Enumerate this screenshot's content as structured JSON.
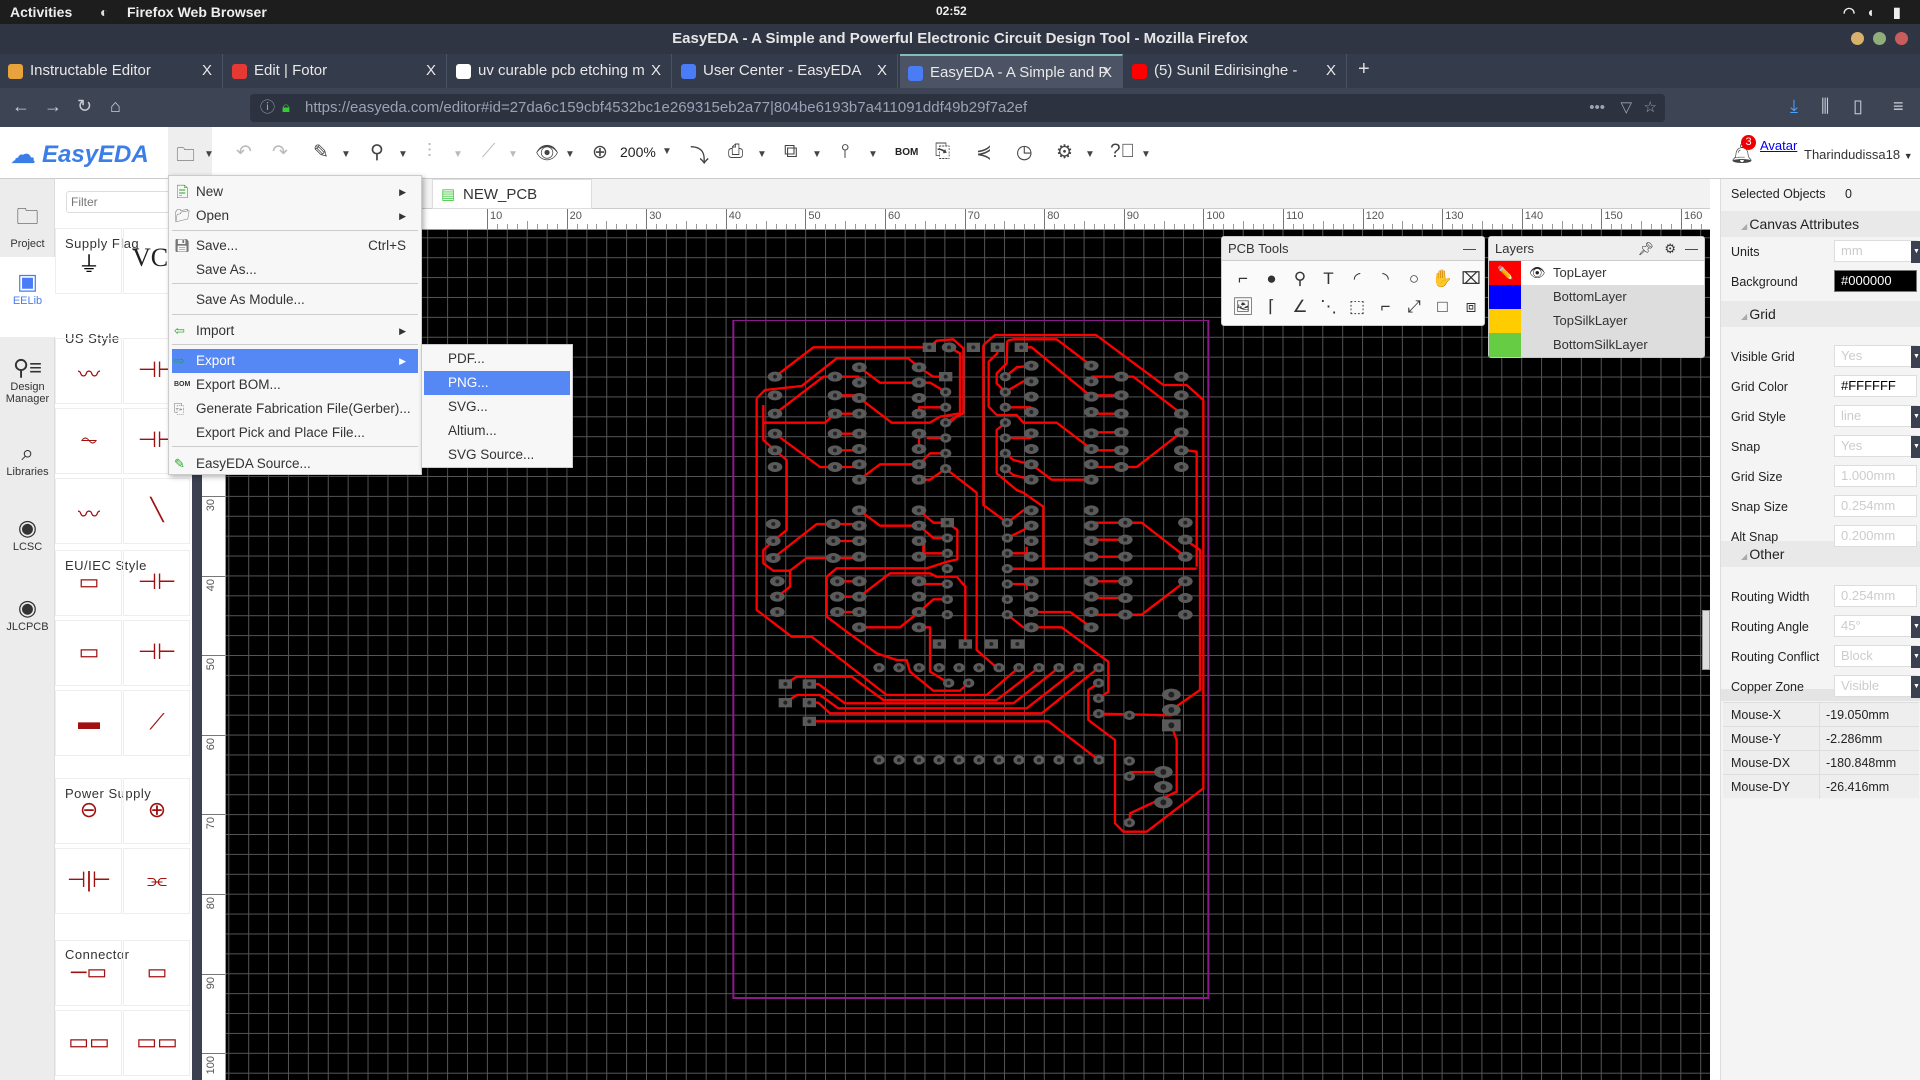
{
  "system": {
    "activities": "Activities",
    "app": "Firefox Web Browser",
    "clock": "02:52"
  },
  "window": {
    "title": "EasyEDA - A Simple and Powerful Electronic Circuit Design Tool - Mozilla Firefox"
  },
  "tabs": [
    {
      "label": "Instructable Editor",
      "color": "#e8a33c"
    },
    {
      "label": "Edit | Fotor",
      "color": "#e53935"
    },
    {
      "label": "uv curable pcb etching m",
      "color": "#ffffff"
    },
    {
      "label": "User Center - EasyEDA",
      "color": "#4a7df5"
    },
    {
      "label": "EasyEDA - A Simple and P",
      "color": "#4a7df5",
      "active": true
    },
    {
      "label": "(5) Sunil Edirisinghe -",
      "color": "#ff0000"
    }
  ],
  "tab_close": "X",
  "new_tab": "+",
  "address": {
    "url": "https://easyeda.com/editor#id=27da6c159cbf4532bc1e269315eb2a77|804be6193b7a411091ddf49b29f7a2ef"
  },
  "app": {
    "logo": "EasyEDA",
    "zoom": "200%",
    "bom": "BOM",
    "notifications": "3",
    "avatar": "Avatar",
    "user": "Tharindudissa18"
  },
  "leftbar": [
    {
      "label": "Project",
      "icon": "folder-icon"
    },
    {
      "label": "EELib",
      "icon": "chip-icon"
    },
    {
      "label": "Design Manager",
      "icon": "tree-icon"
    },
    {
      "label": "Libraries",
      "icon": "search-chip-icon"
    },
    {
      "label": "LCSC",
      "icon": "lcsc-icon"
    },
    {
      "label": "JLCPCB",
      "icon": "jlc-icon"
    }
  ],
  "library": {
    "filter_placeholder": "Filter",
    "sections": [
      "Supply Flag",
      "US Style",
      "EU/IEC Style",
      "Power Supply",
      "Connector"
    ],
    "vcc": "VCC"
  },
  "document": {
    "tab": "NEW_PCB"
  },
  "ruler": {
    "top": [
      "10",
      "20",
      "30",
      "40",
      "50",
      "60",
      "70",
      "80",
      "90",
      "100",
      "110",
      "120",
      "130",
      "140",
      "150",
      "160"
    ],
    "left": [
      "30",
      "40",
      "50",
      "60",
      "70",
      "80",
      "90",
      "100"
    ]
  },
  "menu": {
    "items": [
      {
        "label": "New",
        "arrow": true
      },
      {
        "label": "Open",
        "arrow": true
      },
      {
        "label": "Save...",
        "shortcut": "Ctrl+S"
      },
      {
        "label": "Save As..."
      },
      {
        "label": "Save As Module..."
      },
      {
        "label": "Import",
        "arrow": true
      },
      {
        "label": "Export",
        "arrow": true,
        "highlighted": true
      },
      {
        "label": "Export BOM..."
      },
      {
        "label": "Generate Fabrication File(Gerber)..."
      },
      {
        "label": "Export Pick and Place File..."
      },
      {
        "label": "EasyEDA Source..."
      }
    ],
    "bom_icon": "BOM",
    "export_sub": [
      {
        "label": "PDF..."
      },
      {
        "label": "PNG...",
        "highlighted": true
      },
      {
        "label": "SVG..."
      },
      {
        "label": "Altium..."
      },
      {
        "label": "SVG Source..."
      }
    ]
  },
  "pcb_tools": {
    "title": "PCB Tools"
  },
  "layers": {
    "title": "Layers",
    "items": [
      {
        "name": "TopLayer",
        "color": "#ff0000",
        "active": true
      },
      {
        "name": "BottomLayer",
        "color": "#0000ff"
      },
      {
        "name": "TopSilkLayer",
        "color": "#ffcc00"
      },
      {
        "name": "BottomSilkLayer",
        "color": "#66cc44"
      }
    ]
  },
  "properties": {
    "selected_label": "Selected Objects",
    "selected_count": "0",
    "canvas_title": "Canvas Attributes",
    "units_label": "Units",
    "units": "mm",
    "background_label": "Background",
    "background": "#000000",
    "grid_title": "Grid",
    "visible_grid_label": "Visible Grid",
    "visible_grid": "Yes",
    "grid_color_label": "Grid Color",
    "grid_color": "#FFFFFF",
    "grid_style_label": "Grid Style",
    "grid_style": "line",
    "snap_label": "Snap",
    "snap": "Yes",
    "grid_size_label": "Grid Size",
    "grid_size": "1.000mm",
    "snap_size_label": "Snap Size",
    "snap_size": "0.254mm",
    "alt_snap_label": "Alt Snap",
    "alt_snap": "0.200mm",
    "other_title": "Other",
    "routing_width_label": "Routing Width",
    "routing_width": "0.254mm",
    "routing_angle_label": "Routing Angle",
    "routing_angle": "45°",
    "routing_conflict_label": "Routing Conflict",
    "routing_conflict": "Block",
    "copper_zone_label": "Copper Zone",
    "copper_zone": "Visible",
    "mouse": [
      {
        "label": "Mouse-X",
        "value": "-19.050mm"
      },
      {
        "label": "Mouse-Y",
        "value": "-2.286mm"
      },
      {
        "label": "Mouse-DX",
        "value": "-180.848mm"
      },
      {
        "label": "Mouse-DY",
        "value": "-26.416mm"
      }
    ]
  },
  "colors": {
    "accent": "#5588f5",
    "trace": "#ff0000",
    "board_outline": "#8a1a8a",
    "pad": "#5a5a5a"
  }
}
